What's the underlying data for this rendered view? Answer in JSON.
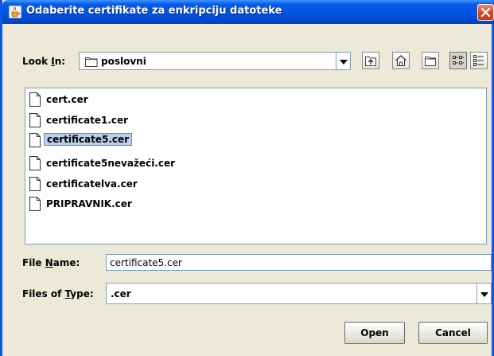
{
  "window": {
    "title": "Odaberite certifikate za enkripciju datoteke",
    "icons": {
      "app": "java-cup-icon",
      "close": "close-icon"
    }
  },
  "lookin": {
    "label_pre": "Look ",
    "label_mnemonic": "I",
    "label_post": "n:",
    "value": "poslovni",
    "icon": "folder-icon"
  },
  "toolbar": {
    "buttons": [
      "up-one-level-icon",
      "home-icon",
      "new-folder-icon",
      "list-view-icon",
      "details-view-icon"
    ]
  },
  "files": [
    {
      "name": "cert.cer",
      "selected": false
    },
    {
      "name": "certificate1.cer",
      "selected": false
    },
    {
      "name": "certificate5.cer",
      "selected": true
    },
    {
      "name": "certificate5nevažeći.cer",
      "selected": false
    },
    {
      "name": "certificatelva.cer",
      "selected": false
    },
    {
      "name": "PRIPRAVNIK.cer",
      "selected": false
    }
  ],
  "filename": {
    "label_pre": "File ",
    "label_mnemonic": "N",
    "label_post": "ame:",
    "value": "certificate5.cer"
  },
  "filetype": {
    "label_pre": "Files of ",
    "label_mnemonic": "T",
    "label_post": "ype:",
    "value": ".cer"
  },
  "buttons": {
    "open": "Open",
    "cancel": "Cancel"
  },
  "colors": {
    "titlebar": "#0055e5",
    "dialog_bg": "#ece9d8",
    "selection": "#bad0ea",
    "field_border": "#7f9db9"
  }
}
